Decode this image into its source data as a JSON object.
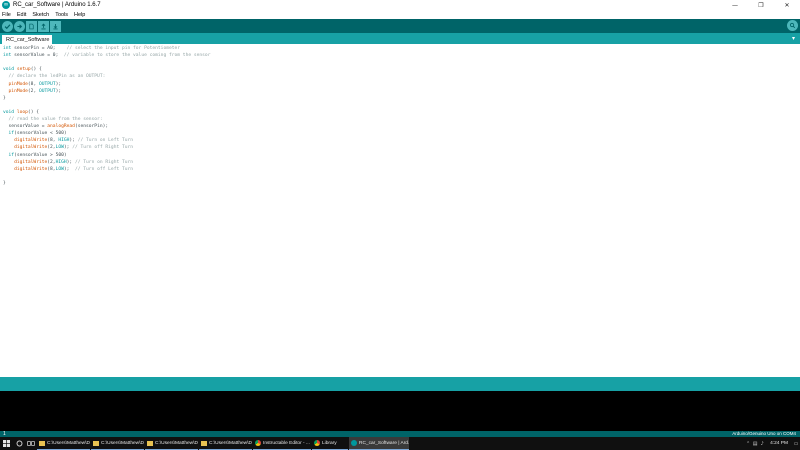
{
  "window": {
    "title": "RC_car_Software | Arduino 1.6.7",
    "controls": [
      "—",
      "❐",
      "✕"
    ]
  },
  "menu": {
    "items": [
      "File",
      "Edit",
      "Sketch",
      "Tools",
      "Help"
    ]
  },
  "toolbar": {
    "icons": [
      "verify-icon",
      "upload-icon",
      "new-icon",
      "open-icon",
      "save-icon",
      "serial-monitor-icon"
    ],
    "color": "#006468"
  },
  "tabs": {
    "active": "RC_car_Software",
    "menu_glyph": "▾"
  },
  "code": [
    {
      "kw": "int ",
      "rest": "sensorPin = A0;    ",
      "comment": "// select the input pin for Potentiometer"
    },
    {
      "kw": "int ",
      "rest": "sensorValue = 0;  ",
      "comment": "// variable to store the value coming from the sensor"
    },
    {
      "kw": "",
      "rest": "",
      "comment": ""
    },
    {
      "kw": "void ",
      "fn": "setup",
      "rest": "() {",
      "comment": ""
    },
    {
      "kw": "",
      "rest": "  ",
      "comment": "// declare the ledPin as an OUTPUT:"
    },
    {
      "kw": "",
      "fn": "  pinMode",
      "rest": "(8, ",
      "cs": "OUTPUT",
      "rest2": ");",
      "comment": ""
    },
    {
      "kw": "",
      "fn": "  pinMode",
      "rest": "(2, ",
      "cs": "OUTPUT",
      "rest2": ");",
      "comment": ""
    },
    {
      "kw": "",
      "rest": "}",
      "comment": ""
    },
    {
      "kw": "",
      "rest": "",
      "comment": ""
    },
    {
      "kw": "void ",
      "fn": "loop",
      "rest": "() {",
      "comment": ""
    },
    {
      "kw": "",
      "rest": "  ",
      "comment": "// read the value from the sensor:"
    },
    {
      "kw": "",
      "rest": "  sensorValue = ",
      "fn2": "analogRead",
      "rest2": "(sensorPin);",
      "comment": ""
    },
    {
      "kw": "  if",
      "rest": "(sensorValue < 500)",
      "comment": ""
    },
    {
      "kw": "",
      "fn": "    digitalWrite",
      "rest": "(8, ",
      "cs": "HIGH",
      "rest2": "); ",
      "comment": "// Turn on Left Turn"
    },
    {
      "kw": "",
      "fn": "    digitalWrite",
      "rest": "(2,",
      "cs": "LOW",
      "rest2": "); ",
      "comment": "// Turn off Right Turn"
    },
    {
      "kw": "  if",
      "rest": "(sensorValue > 500)",
      "comment": ""
    },
    {
      "kw": "",
      "fn": "    digitalWrite",
      "rest": "(2,",
      "cs": "HIGH",
      "rest2": "); ",
      "comment": "// Turn on Right Turn"
    },
    {
      "kw": "",
      "fn": "    digitalWrite",
      "rest": "(8,",
      "cs": "LOW",
      "rest2": ");  ",
      "comment": "// Turn off Left Turn"
    },
    {
      "kw": "",
      "rest": "",
      "comment": ""
    },
    {
      "kw": "",
      "rest": "}",
      "comment": ""
    }
  ],
  "board": {
    "line": "1",
    "info": "Arduino/Genuino Uno on COM4"
  },
  "taskbar": {
    "apps": [
      {
        "label": "C:\\Users\\Matthew\\De...",
        "type": "folder",
        "active": false
      },
      {
        "label": "C:\\Users\\Matthew\\De...",
        "type": "folder",
        "active": false
      },
      {
        "label": "C:\\Users\\Matthew\\De...",
        "type": "folder",
        "active": false
      },
      {
        "label": "C:\\Users\\Matthew\\De...",
        "type": "folder",
        "active": false
      },
      {
        "label": "Instructable Editor - ...",
        "type": "chrome",
        "active": false
      },
      {
        "label": "Library",
        "type": "chrome",
        "active": false
      },
      {
        "label": "RC_car_Software | Ard...",
        "type": "arduino",
        "active": true
      }
    ],
    "clock_time": "4:24 PM"
  }
}
